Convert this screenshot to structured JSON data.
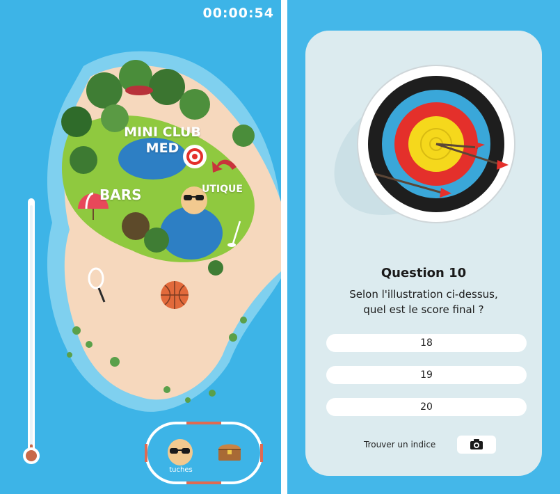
{
  "left_panel": {
    "timer": "00:00:54",
    "map_labels": {
      "mini_club_line1": "MINI CLUB",
      "mini_club_line2": "MED",
      "bars": "BARS",
      "boutique": "UTIQUE"
    },
    "thermometer_level": 0.04,
    "dock": {
      "avatar_label": "tuches",
      "icons": [
        "avatar-with-sunglasses-icon",
        "treasure-chest-icon"
      ]
    }
  },
  "right_panel": {
    "question_title": "Question 10",
    "question_line1": "Selon l'illustration ci-dessus,",
    "question_line2": "quel est le score final ?",
    "answers": [
      "18",
      "19",
      "20"
    ],
    "hint_label": "Trouver un indice",
    "hint_icon": "camera-icon"
  },
  "colors": {
    "sky": "#3db4e7",
    "card": "#dcebef",
    "target_yellow": "#f5d81c",
    "target_red": "#e4302b",
    "target_blue": "#3aa7d9",
    "target_black": "#1a1a1a",
    "thermo_fill": "#c8694a"
  }
}
